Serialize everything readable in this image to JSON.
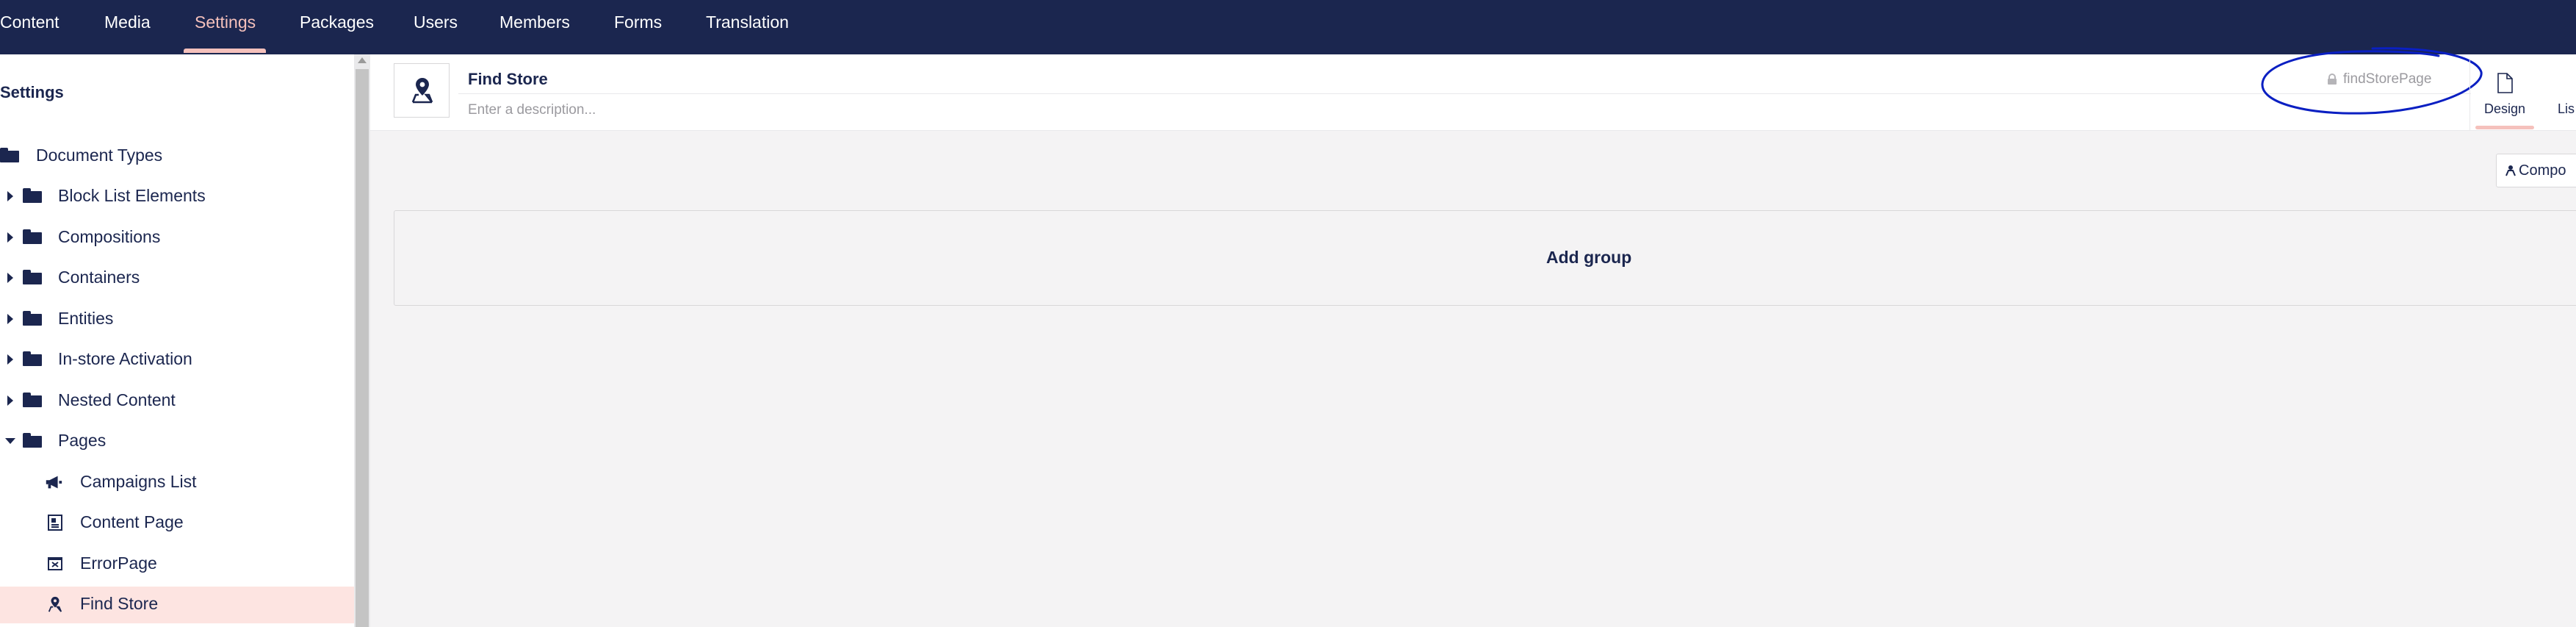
{
  "topnav": {
    "items": [
      {
        "label": "Content"
      },
      {
        "label": "Media"
      },
      {
        "label": "Settings",
        "active": true
      },
      {
        "label": "Packages"
      },
      {
        "label": "Users"
      },
      {
        "label": "Members"
      },
      {
        "label": "Forms"
      },
      {
        "label": "Translation"
      }
    ]
  },
  "sidebar": {
    "title": "Settings",
    "tree": [
      {
        "label": "Document Types",
        "icon": "folder-icon"
      },
      {
        "label": "Block List Elements",
        "icon": "folder-icon",
        "caret": "collapsed"
      },
      {
        "label": "Compositions",
        "icon": "folder-icon",
        "caret": "collapsed"
      },
      {
        "label": "Containers",
        "icon": "folder-icon",
        "caret": "collapsed"
      },
      {
        "label": "Entities",
        "icon": "folder-icon",
        "caret": "collapsed"
      },
      {
        "label": "In-store Activation",
        "icon": "folder-icon",
        "caret": "collapsed"
      },
      {
        "label": "Nested Content",
        "icon": "folder-icon",
        "caret": "collapsed"
      },
      {
        "label": "Pages",
        "icon": "folder-icon",
        "caret": "expanded"
      },
      {
        "label": "Campaigns List",
        "icon": "megaphone-icon"
      },
      {
        "label": "Content Page",
        "icon": "document-icon"
      },
      {
        "label": "ErrorPage",
        "icon": "error-page-icon"
      },
      {
        "label": "Find Store",
        "icon": "map-pin-icon",
        "selected": true
      }
    ]
  },
  "editor": {
    "name": "Find Store",
    "description_placeholder": "Enter a description...",
    "alias": "findStorePage",
    "tabs": [
      {
        "label": "Design",
        "icon": "document-icon",
        "active": true
      },
      {
        "label": "Lis",
        "icon": "list-icon"
      }
    ],
    "compositions_label": "Compo",
    "add_group_label": "Add group"
  },
  "colors": {
    "nav_bg": "#1b264f",
    "accent": "#f5c1bc",
    "selected_bg": "#fde4e1",
    "annotation": "#0a1fc2"
  }
}
